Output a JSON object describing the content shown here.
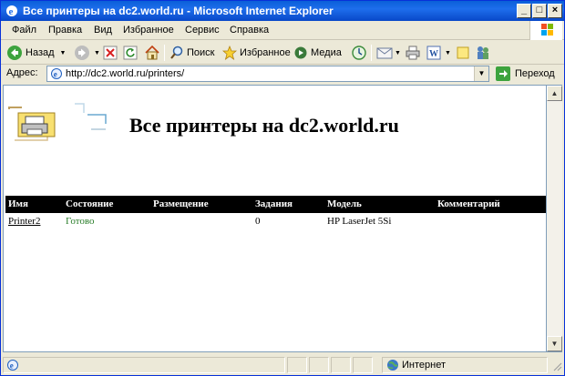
{
  "window": {
    "title": "Все принтеры на dc2.world.ru - Microsoft Internet Explorer"
  },
  "menu": {
    "items": [
      "Файл",
      "Правка",
      "Вид",
      "Избранное",
      "Сервис",
      "Справка"
    ]
  },
  "toolbar": {
    "back_label": "Назад",
    "search_label": "Поиск",
    "favorites_label": "Избранное",
    "media_label": "Медиа"
  },
  "address": {
    "label": "Адрес:",
    "url": "http://dc2.world.ru/printers/",
    "go_label": "Переход"
  },
  "page": {
    "heading": "Все принтеры на dc2.world.ru",
    "columns": [
      "Имя",
      "Состояние",
      "Размещение",
      "Задания",
      "Модель",
      "Комментарий"
    ],
    "rows": [
      {
        "name": "Printer2",
        "status": "Готово",
        "location": "",
        "jobs": "0",
        "model": "HP LaserJet 5Si",
        "comment": ""
      }
    ]
  },
  "statusbar": {
    "zone": "Интернет"
  }
}
